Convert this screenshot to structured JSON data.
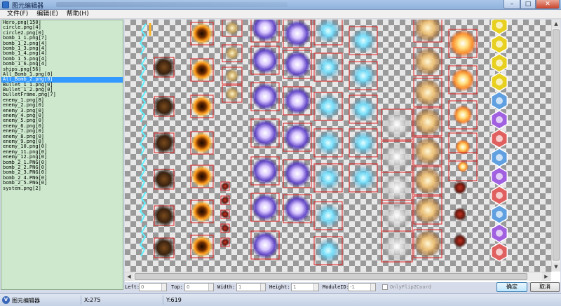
{
  "window": {
    "title": "图元编辑器"
  },
  "menu": [
    {
      "label": "文件(F)"
    },
    {
      "label": "编辑(E)"
    },
    {
      "label": "帮助(H)"
    }
  ],
  "files": [
    "Hero.png[150]",
    "circle.png[4]",
    "circle2.png[0]",
    "bomb_1_1.png[7]",
    "bomb_1_2.png[4]",
    "bomb_1_3.png[4]",
    "bomb_1_4.png[4]",
    "bomb_1_5.png[4]",
    "bomb_1_6.png[4]",
    "ships.png[56]",
    "All_Bomb_1.png[0]",
    "All_Bomb_2.png[0]",
    "Bullet_1_1.png[0]",
    "Bullet_1_2.png[0]",
    "bulletFrame.png[7]",
    "enemy_1.png[8]",
    "enemy_2.png[0]",
    "enemy_3.png[0]",
    "enemy_4.png[0]",
    "enemy_5.png[0]",
    "enemy_6.png[0]",
    "enemy_7.png[0]",
    "enemy_8.png[0]",
    "enemy_9.png[0]",
    "enemy_10.png[0]",
    "enemy_11.png[0]",
    "enemy_12.png[0]",
    "bomb_2_1.PNG[0]",
    "bomb_2_2.PNG[0]",
    "bomb_2_3.PNG[0]",
    "bomb_2_4.PNG[0]",
    "bomb_2_5.PNG[0]",
    "system.png[2]"
  ],
  "selected_file_index": 11,
  "fields": {
    "left_label": "Left:",
    "left_value": "0",
    "top_label": "Top:",
    "top_value": "0",
    "width_label": "Width:",
    "width_value": "1",
    "height_label": "Height:",
    "height_value": "1",
    "module_label": "ModuleID:",
    "module_value": "-1",
    "flip_label": "OnlyFlip2Coord"
  },
  "buttons": {
    "ok": "确定",
    "cancel": "取消"
  },
  "status": {
    "title": "图元编辑器",
    "x": "X:275",
    "y": "Y:619"
  },
  "colors": {
    "file_list_bg": "#cde8cd",
    "selection": "#3399ff",
    "frame_border": "#e02020"
  },
  "icons": [
    "app-icon",
    "minimize-icon",
    "maximize-icon",
    "close-icon",
    "scroll-up-icon",
    "scroll-down-icon",
    "scroll-left-icon",
    "scroll-right-icon"
  ]
}
